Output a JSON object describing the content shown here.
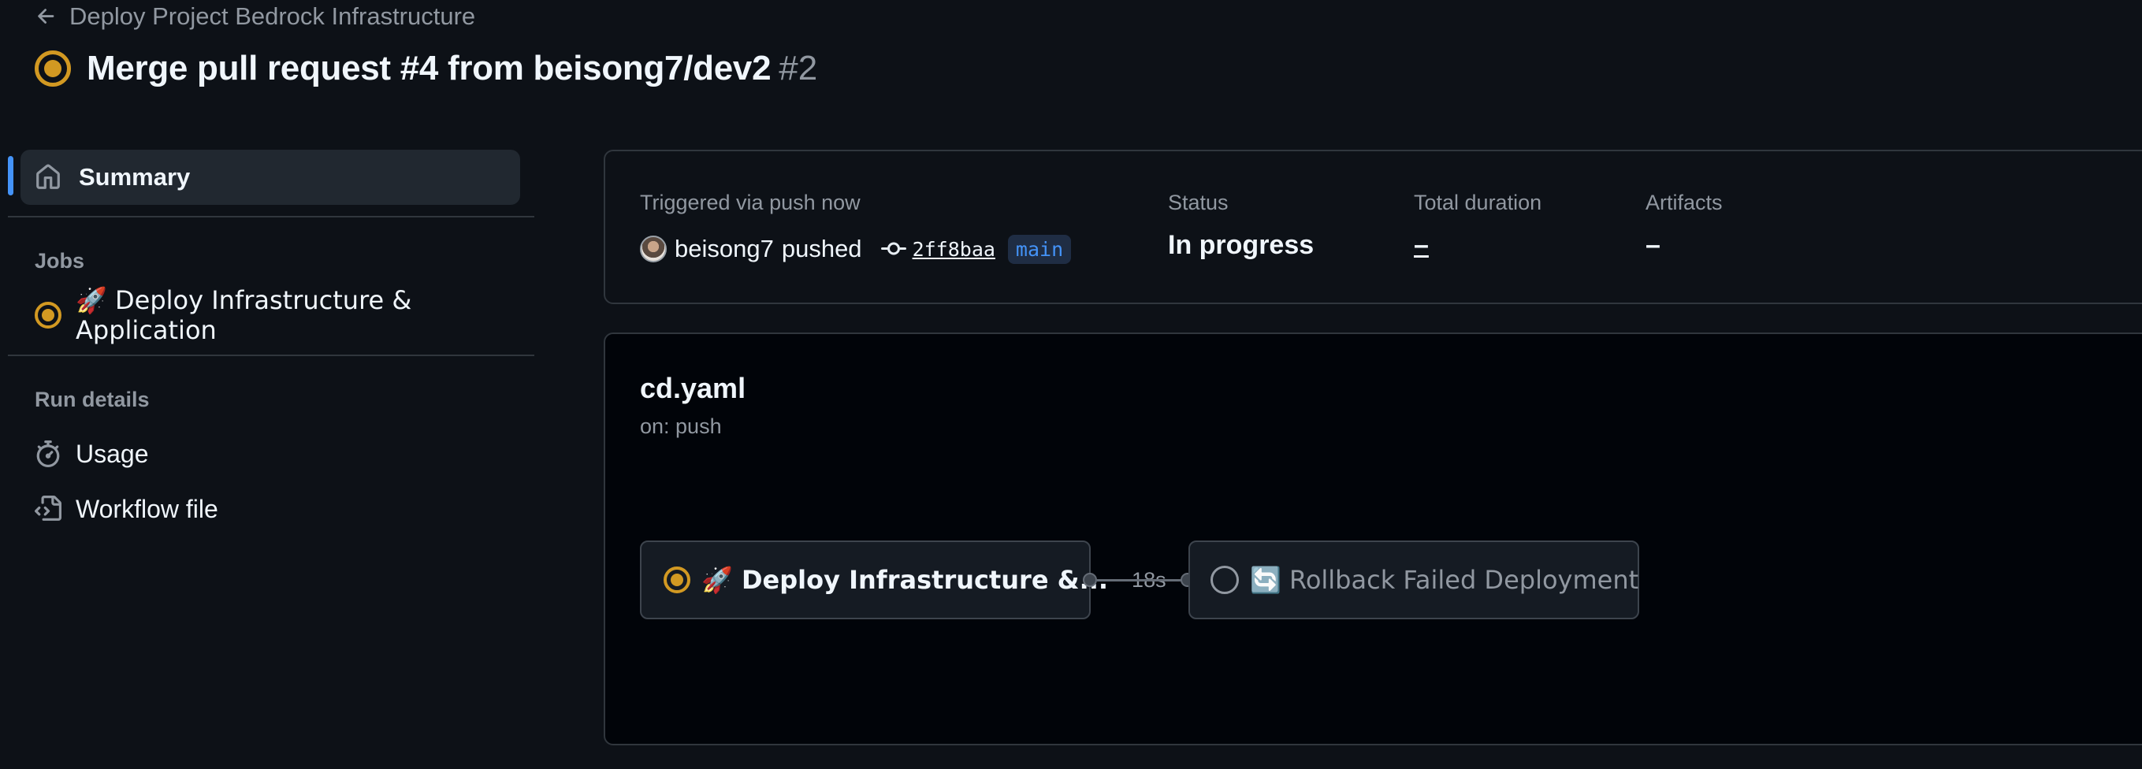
{
  "header": {
    "back_label": "Deploy Project Bedrock Infrastructure",
    "title": "Merge pull request #4 from beisong7/dev2",
    "run_number": "#2"
  },
  "sidebar": {
    "summary_label": "Summary",
    "jobs_heading": "Jobs",
    "jobs": [
      {
        "label": "🚀 Deploy Infrastructure & Application",
        "status": "in_progress"
      }
    ],
    "run_details_heading": "Run details",
    "details": [
      {
        "label": "Usage",
        "icon": "stopwatch-icon"
      },
      {
        "label": "Workflow file",
        "icon": "file-code-icon"
      }
    ]
  },
  "summary": {
    "trigger_label": "Triggered via push now",
    "actor": "beisong7",
    "action": "pushed",
    "commit": "2ff8baa",
    "branch": "main",
    "status_label": "Status",
    "status_value": "In progress",
    "duration_label": "Total duration",
    "duration_value": "–",
    "artifacts_label": "Artifacts",
    "artifacts_value": "–"
  },
  "workflow": {
    "file": "cd.yaml",
    "trigger": "on: push",
    "jobs": [
      {
        "label": "🚀 Deploy Infrastructure &...",
        "duration": "18s",
        "status": "in_progress"
      },
      {
        "label": "🔄 Rollback Failed Deployment",
        "duration": "",
        "status": "pending"
      }
    ]
  },
  "colors": {
    "background": "#0d1117",
    "in_progress": "#d29922",
    "accent": "#4493f8",
    "border": "#30363d",
    "muted_text": "#9198a1"
  }
}
